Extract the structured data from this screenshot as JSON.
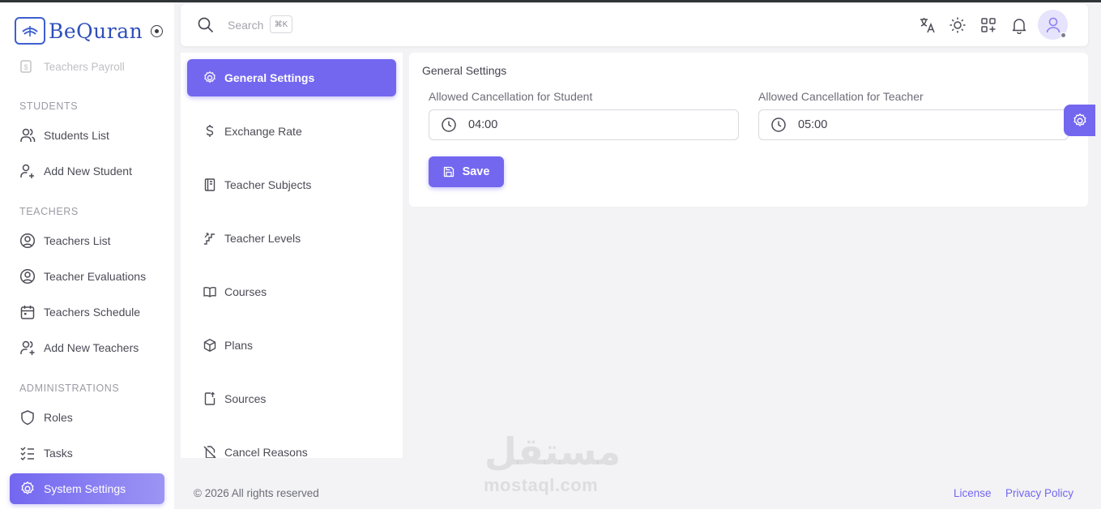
{
  "app": {
    "name": "BeQuran"
  },
  "sidebar": {
    "faded_item": "Teachers Payroll",
    "sections": {
      "students": "STUDENTS",
      "teachers": "TEACHERS",
      "administrations": "ADMINISTRATIONS"
    },
    "items": {
      "students_list": "Students List",
      "add_new_student": "Add New Student",
      "teachers_list": "Teachers List",
      "teacher_evaluations": "Teacher Evaluations",
      "teachers_schedule": "Teachers Schedule",
      "add_new_teachers": "Add New Teachers",
      "roles": "Roles",
      "tasks": "Tasks",
      "system_settings": "System Settings"
    },
    "active_item": "System Settings"
  },
  "header": {
    "search_placeholder": "Search",
    "search_shortcut": "⌘K"
  },
  "settings_menu": {
    "items": [
      {
        "label": "General Settings",
        "icon": "gear-icon",
        "active": true
      },
      {
        "label": "Exchange Rate",
        "icon": "dollar-icon",
        "active": false
      },
      {
        "label": "Teacher Subjects",
        "icon": "book-icon",
        "active": false
      },
      {
        "label": "Teacher Levels",
        "icon": "stairs-icon",
        "active": false
      },
      {
        "label": "Courses",
        "icon": "open-book-icon",
        "active": false
      },
      {
        "label": "Plans",
        "icon": "box-icon",
        "active": false
      },
      {
        "label": "Sources",
        "icon": "file-upload-icon",
        "active": false
      },
      {
        "label": "Cancel Reasons",
        "icon": "file-off-icon",
        "active": false
      }
    ]
  },
  "general_settings": {
    "title": "General Settings",
    "student_label": "Allowed Cancellation for Student",
    "student_value": "04:00",
    "teacher_label": "Allowed Cancellation for Teacher",
    "teacher_value": "05:00",
    "save_label": "Save"
  },
  "footer": {
    "copyright": "© 2026 All rights reserved",
    "license": "License",
    "privacy": "Privacy Policy"
  },
  "watermark": {
    "arabic": "مستقل",
    "latin": "mostaql.com"
  },
  "colors": {
    "primary": "#7367f0",
    "logo": "#2e4fb8"
  }
}
